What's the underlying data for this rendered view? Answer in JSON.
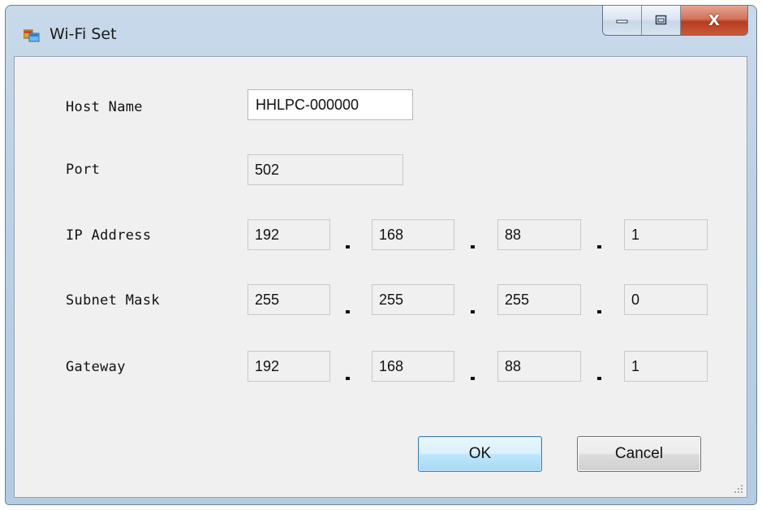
{
  "window": {
    "title": "Wi-Fi Set"
  },
  "caption_buttons": {
    "minimize": "minimize-icon",
    "maximize": "maximize-icon",
    "close_label": "X"
  },
  "form": {
    "host_name": {
      "label": "Host Name",
      "value": "HHLPC-000000"
    },
    "port": {
      "label": "Port",
      "value": "502"
    },
    "ip_address": {
      "label": "IP Address",
      "octets": [
        "192",
        "168",
        "88",
        "1"
      ]
    },
    "subnet_mask": {
      "label": "Subnet Mask",
      "octets": [
        "255",
        "255",
        "255",
        "0"
      ]
    },
    "gateway": {
      "label": "Gateway",
      "octets": [
        "192",
        "168",
        "88",
        "1"
      ]
    }
  },
  "buttons": {
    "ok": "OK",
    "cancel": "Cancel"
  },
  "colors": {
    "close_button": "#c8482a",
    "ok_border": "#3c7fb1",
    "client_bg": "#f0f0f0"
  }
}
